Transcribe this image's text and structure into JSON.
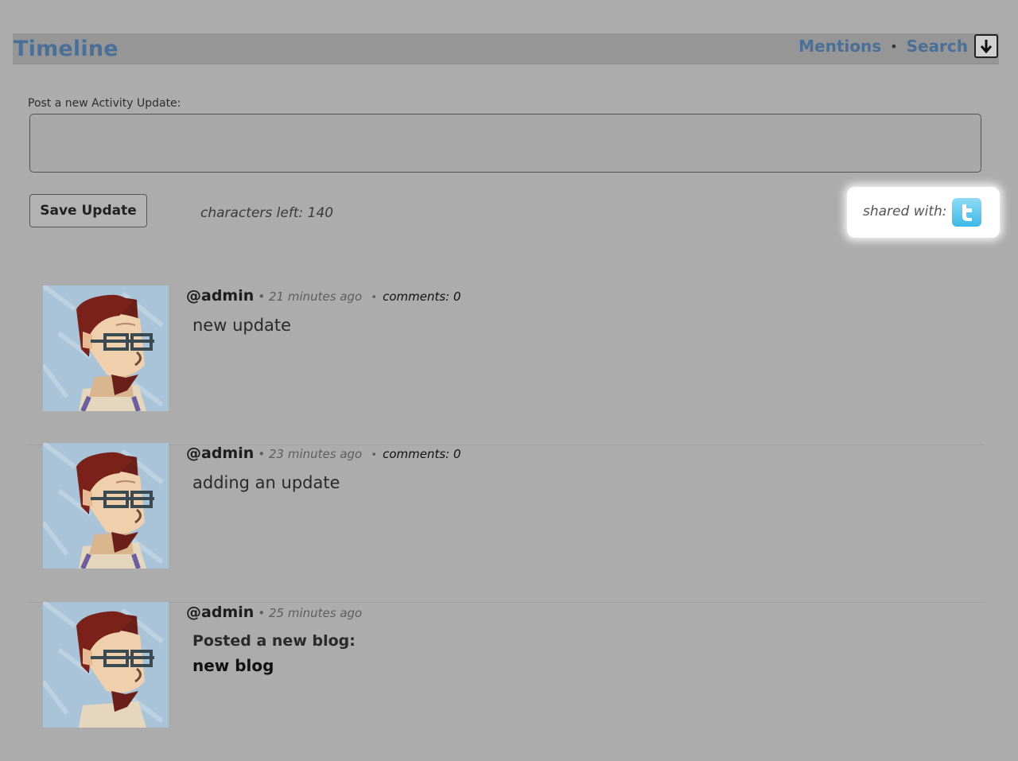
{
  "header": {
    "title": "Timeline",
    "nav": {
      "mentions": "Mentions",
      "separator": "•",
      "search": "Search"
    },
    "dropdown_icon": "arrow-down-icon"
  },
  "composer": {
    "label": "Post a new Activity Update:",
    "placeholder": "",
    "value": "",
    "save_label": "Save Update",
    "chars_left": "characters left: 140",
    "shared_with_label": "shared with:",
    "shared_icon": "twitter-icon",
    "twitter_color": "#3cb7e8"
  },
  "accent_color": "#4a7098",
  "feed": [
    {
      "user": "@admin",
      "time": "• 21 minutes ago",
      "comments_sep": "•",
      "comments": "comments: 0",
      "body": "new update"
    },
    {
      "user": "@admin",
      "time": "• 23 minutes ago",
      "comments_sep": "•",
      "comments": "comments: 0",
      "body": "adding an update"
    },
    {
      "user": "@admin",
      "time": "• 25 minutes ago",
      "blog_heading": "Posted a new blog:",
      "blog_title": "new blog",
      "blog_excerpt": ""
    }
  ]
}
